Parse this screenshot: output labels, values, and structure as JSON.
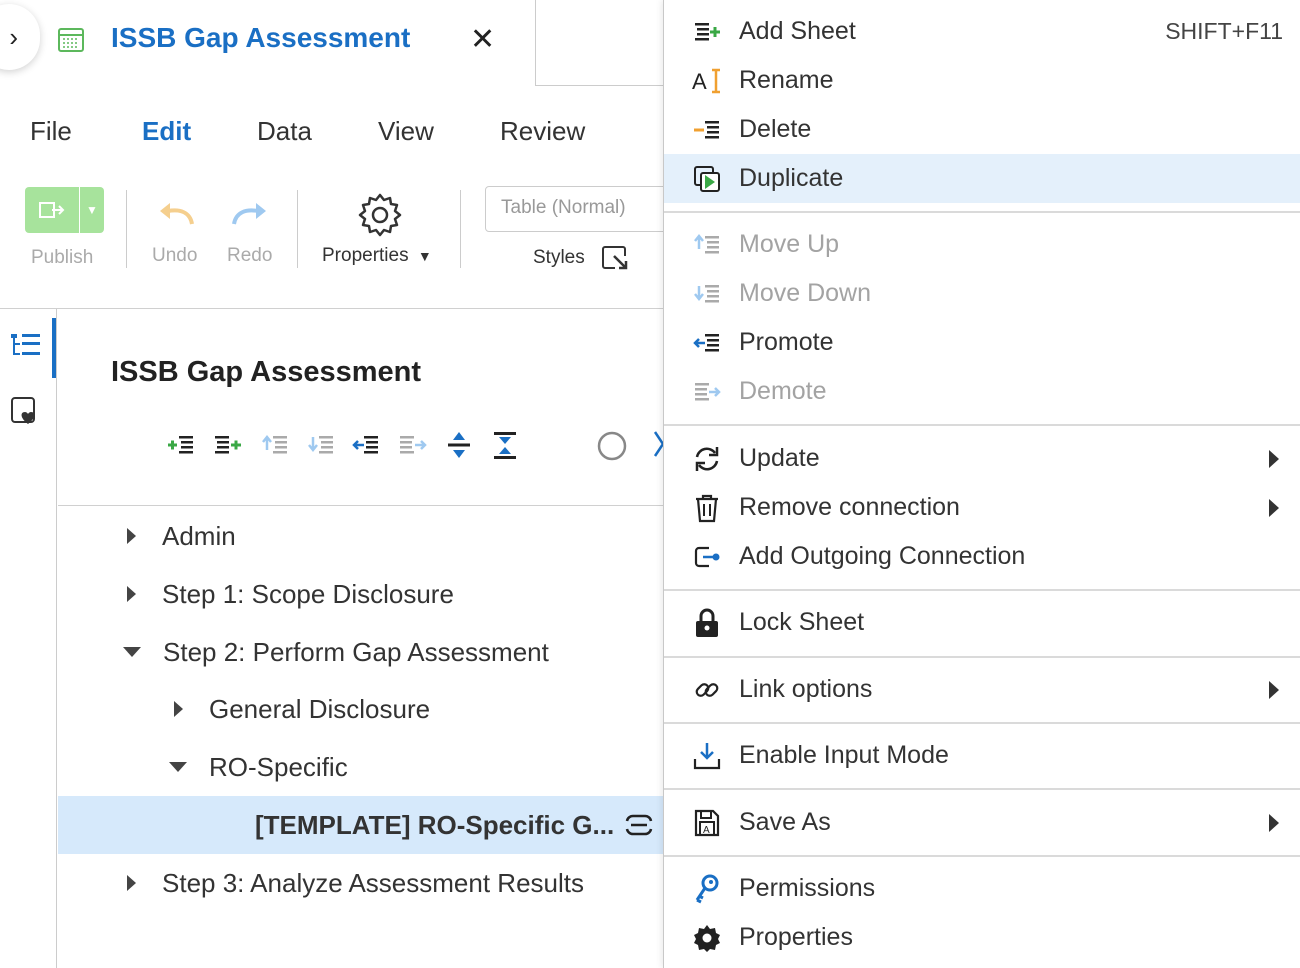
{
  "header": {
    "expand_glyph": "›",
    "doc_title": "ISSB Gap Assessment",
    "close_glyph": "✕"
  },
  "menubar": [
    "File",
    "Edit",
    "Data",
    "View",
    "Review"
  ],
  "toolbar": {
    "publish": "Publish",
    "undo": "Undo",
    "redo": "Redo",
    "properties": "Properties",
    "styles_select": "Table (Normal)",
    "styles": "Styles"
  },
  "panel": {
    "title": "ISSB Gap Assessment"
  },
  "tree": [
    {
      "label": "Admin",
      "caret": "right",
      "level": 0
    },
    {
      "label": "Step 1: Scope Disclosure",
      "caret": "right",
      "level": 0
    },
    {
      "label": "Step 2: Perform Gap Assessment",
      "caret": "down",
      "level": 0
    },
    {
      "label": "General Disclosure",
      "caret": "right",
      "level": 1
    },
    {
      "label": "RO-Specific",
      "caret": "down",
      "level": 1
    },
    {
      "label": "[TEMPLATE] RO-Specific G...",
      "caret": "none",
      "level": 2,
      "selected": true
    },
    {
      "label": "Step 3: Analyze Assessment Results",
      "caret": "right",
      "level": 0
    }
  ],
  "context_menu": {
    "add_sheet": "Add Sheet",
    "add_sheet_shortcut": "SHIFT+F11",
    "rename": "Rename",
    "delete": "Delete",
    "duplicate": "Duplicate",
    "move_up": "Move Up",
    "move_down": "Move Down",
    "promote": "Promote",
    "demote": "Demote",
    "update": "Update",
    "remove_connection": "Remove connection",
    "add_outgoing_connection": "Add Outgoing Connection",
    "lock_sheet": "Lock Sheet",
    "link_options": "Link options",
    "enable_input_mode": "Enable Input Mode",
    "save_as": "Save As",
    "permissions": "Permissions",
    "properties": "Properties"
  },
  "colors": {
    "accent": "#1a6fc4",
    "selection": "#d6e9fb",
    "hover": "#e4f0fb",
    "green": "#5cb85c"
  }
}
